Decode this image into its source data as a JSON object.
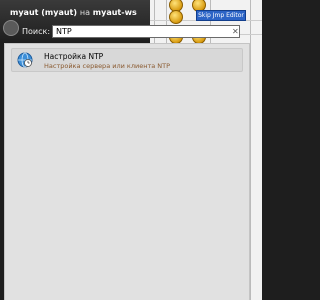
{
  "header": {
    "user": "myaut (myaut)",
    "on": "на",
    "host": "myaut-ws"
  },
  "search": {
    "label": "Поиск:",
    "value": "NTP",
    "clear_glyph": "✕"
  },
  "results": [
    {
      "title": "Настройка NTP",
      "subtitle": "Настройка сервера или клиента NTP",
      "icon": "clock-globe-icon"
    }
  ],
  "background": {
    "badge": "Skip Jmp Editor"
  },
  "colors": {
    "header_bg": "#2b2b2b",
    "panel_bg": "#e1e1e1",
    "subtitle": "#8a5a30",
    "badge_bg": "#2c64c6"
  }
}
